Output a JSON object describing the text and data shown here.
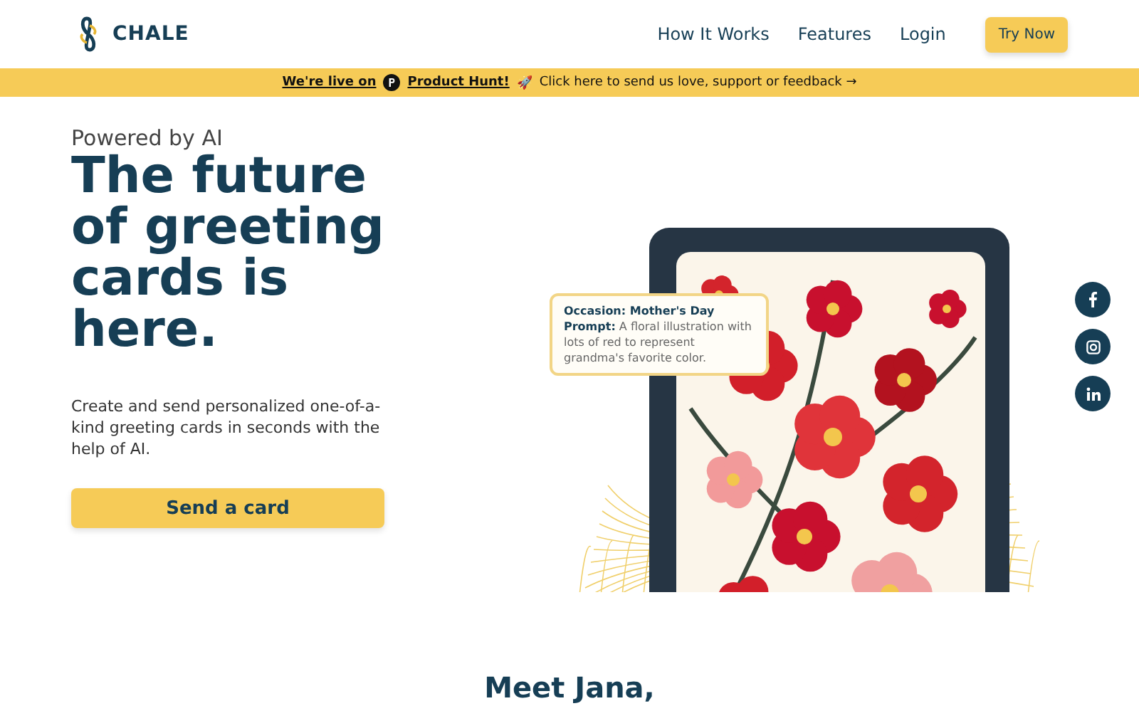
{
  "header": {
    "brand": "CHALE",
    "nav": [
      {
        "label": "How It Works",
        "kind": "link"
      },
      {
        "label": "Features",
        "kind": "link"
      },
      {
        "label": "Login",
        "kind": "link"
      },
      {
        "label": "Try Now",
        "kind": "button"
      }
    ]
  },
  "banner": {
    "lead": "We're live on",
    "product": "Product Hunt!",
    "emoji": "🚀",
    "message": "Click here to send us love, support or feedback →"
  },
  "hero": {
    "eyebrow": "Powered by AI",
    "headline": "The future of greeting cards is here.",
    "description": "Create and send personalized one-of-a-kind greeting cards in seconds with the help of AI.",
    "cta": "Send a card",
    "prompt_card": {
      "occasion": "Occasion: Mother's Day",
      "prompt": "**Prompt:** A floral illustration with lots of red to represent grandma's favorite color."
    }
  },
  "social": [
    {
      "kind": "facebook"
    },
    {
      "kind": "instagram"
    },
    {
      "kind": "linkedin"
    }
  ],
  "next_section": {
    "heading": "Meet Jana,"
  }
}
